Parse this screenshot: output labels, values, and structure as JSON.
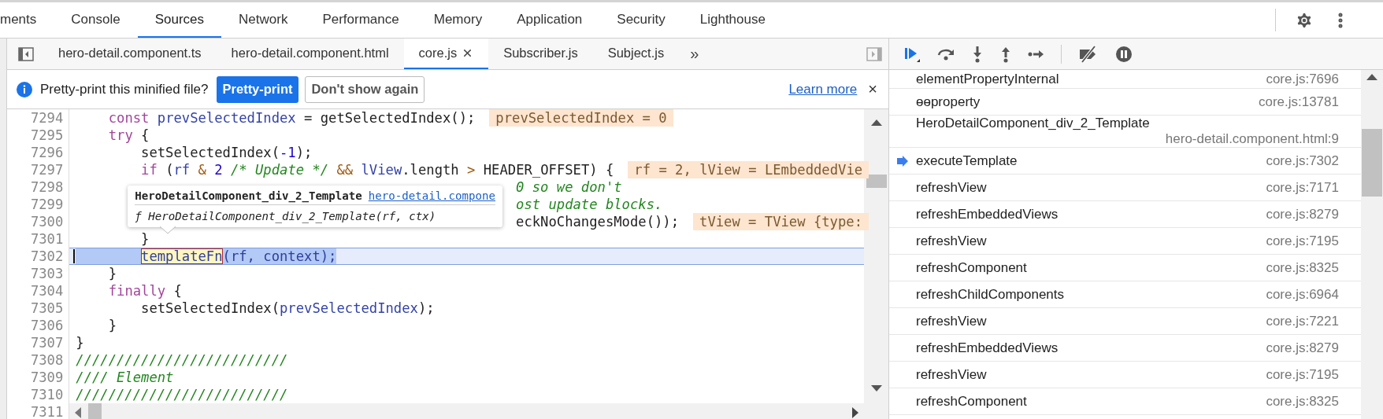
{
  "main_tabs": [
    {
      "label": "ments",
      "selected": false
    },
    {
      "label": "Console",
      "selected": false
    },
    {
      "label": "Sources",
      "selected": true
    },
    {
      "label": "Network",
      "selected": false
    },
    {
      "label": "Performance",
      "selected": false
    },
    {
      "label": "Memory",
      "selected": false
    },
    {
      "label": "Application",
      "selected": false
    },
    {
      "label": "Security",
      "selected": false
    },
    {
      "label": "Lighthouse",
      "selected": false
    }
  ],
  "file_tabs": [
    {
      "label": "hero-detail.component.ts",
      "selected": false,
      "closable": false
    },
    {
      "label": "hero-detail.component.html",
      "selected": false,
      "closable": false
    },
    {
      "label": "core.js",
      "selected": true,
      "closable": true
    },
    {
      "label": "Subscriber.js",
      "selected": false,
      "closable": false
    },
    {
      "label": "Subject.js",
      "selected": false,
      "closable": false
    }
  ],
  "more_tabs": "»",
  "info_bar": {
    "message": "Pretty-print this minified file?",
    "primary_button": "Pretty-print",
    "secondary_button": "Don't show again",
    "link": "Learn more",
    "close": "×"
  },
  "code": {
    "lines": [
      {
        "number": "7294",
        "current": false,
        "tokens": [
          {
            "text": "    const",
            "kind": "keyword"
          },
          {
            "text": " prevSelectedIndex",
            "kind": "def"
          },
          {
            "text": " = getSelectedIndex();",
            "kind": "plain"
          }
        ],
        "inline_value": "prevSelectedIndex = 0"
      },
      {
        "number": "7295",
        "current": false,
        "tokens": [
          {
            "text": "    try",
            "kind": "keyword"
          },
          {
            "text": " {",
            "kind": "plain"
          }
        ]
      },
      {
        "number": "7296",
        "current": false,
        "tokens": [
          {
            "text": "        setSelectedIndex(",
            "kind": "plain"
          },
          {
            "text": "-1",
            "kind": "number"
          },
          {
            "text": ");",
            "kind": "plain"
          }
        ]
      },
      {
        "number": "7297",
        "current": false,
        "tokens": [
          {
            "text": "        if",
            "kind": "keyword"
          },
          {
            "text": " (",
            "kind": "plain"
          },
          {
            "text": "rf",
            "kind": "def"
          },
          {
            "text": " &",
            "kind": "operator"
          },
          {
            "text": " 2",
            "kind": "number"
          },
          {
            "text": " /* Update */",
            "kind": "comment"
          },
          {
            "text": " &&",
            "kind": "operator"
          },
          {
            "text": " lView",
            "kind": "def"
          },
          {
            "text": ".length ",
            "kind": "plain"
          },
          {
            "text": ">",
            "kind": "operator"
          },
          {
            "text": " HEADER_OFFSET) {",
            "kind": "plain"
          }
        ],
        "inline_value": "rf = 2, lView = LEmbeddedVie"
      },
      {
        "number": "7298",
        "current": false,
        "tokens": [
          {
            "text": "                                                      0 so we don't",
            "kind": "comment"
          }
        ]
      },
      {
        "number": "7299",
        "current": false,
        "tokens": [
          {
            "text": "                                                      ost update blocks.",
            "kind": "comment"
          }
        ]
      },
      {
        "number": "7300",
        "current": false,
        "tokens": [
          {
            "text": "                                                      eckNoChangesMode());",
            "kind": "plain"
          }
        ],
        "inline_value": "tView = TView {type:"
      },
      {
        "number": "7301",
        "current": false,
        "tokens": [
          {
            "text": "        }",
            "kind": "plain"
          }
        ]
      },
      {
        "number": "7302",
        "current": true,
        "tokens": [
          {
            "text": "        templateFn",
            "kind": "hover"
          },
          {
            "text": "(rf, context);",
            "kind": "selected"
          }
        ]
      },
      {
        "number": "7303",
        "current": false,
        "tokens": [
          {
            "text": "    }",
            "kind": "plain"
          }
        ]
      },
      {
        "number": "7304",
        "current": false,
        "tokens": [
          {
            "text": "    finally",
            "kind": "keyword"
          },
          {
            "text": " {",
            "kind": "plain"
          }
        ]
      },
      {
        "number": "7305",
        "current": false,
        "tokens": [
          {
            "text": "        setSelectedIndex(",
            "kind": "plain"
          },
          {
            "text": "prevSelectedIndex",
            "kind": "def"
          },
          {
            "text": ");",
            "kind": "plain"
          }
        ]
      },
      {
        "number": "7306",
        "current": false,
        "tokens": [
          {
            "text": "    }",
            "kind": "plain"
          }
        ]
      },
      {
        "number": "7307",
        "current": false,
        "tokens": [
          {
            "text": "}",
            "kind": "plain"
          }
        ]
      },
      {
        "number": "7308",
        "current": false,
        "tokens": [
          {
            "text": "//////////////////////////",
            "kind": "comment"
          }
        ]
      },
      {
        "number": "7309",
        "current": false,
        "tokens": [
          {
            "text": "//// Element",
            "kind": "comment"
          }
        ]
      },
      {
        "number": "7310",
        "current": false,
        "tokens": [
          {
            "text": "//////////////////////////",
            "kind": "comment"
          }
        ]
      },
      {
        "number": "7311"
      }
    ]
  },
  "tooltip": {
    "title": "HeroDetailComponent_div_2_Template",
    "link": "hero-detail.compone",
    "signature": "ƒ HeroDetailComponent_div_2_Template(rf, ctx)"
  },
  "call_stack": [
    {
      "name": "elementPropertyInternal",
      "location": "core.js:7696",
      "current": false
    },
    {
      "name": "ɵɵproperty",
      "location": "core.js:13781",
      "current": false
    },
    {
      "name": "HeroDetailComponent_div_2_Template",
      "location": "hero-detail.component.html:9",
      "current": false
    },
    {
      "name": "executeTemplate",
      "location": "core.js:7302",
      "current": true
    },
    {
      "name": "refreshView",
      "location": "core.js:7171",
      "current": false
    },
    {
      "name": "refreshEmbeddedViews",
      "location": "core.js:8279",
      "current": false
    },
    {
      "name": "refreshView",
      "location": "core.js:7195",
      "current": false
    },
    {
      "name": "refreshComponent",
      "location": "core.js:8325",
      "current": false
    },
    {
      "name": "refreshChildComponents",
      "location": "core.js:6964",
      "current": false
    },
    {
      "name": "refreshView",
      "location": "core.js:7221",
      "current": false
    },
    {
      "name": "refreshEmbeddedViews",
      "location": "core.js:8279",
      "current": false
    },
    {
      "name": "refreshView",
      "location": "core.js:7195",
      "current": false
    },
    {
      "name": "refreshComponent",
      "location": "core.js:8325",
      "current": false
    }
  ]
}
